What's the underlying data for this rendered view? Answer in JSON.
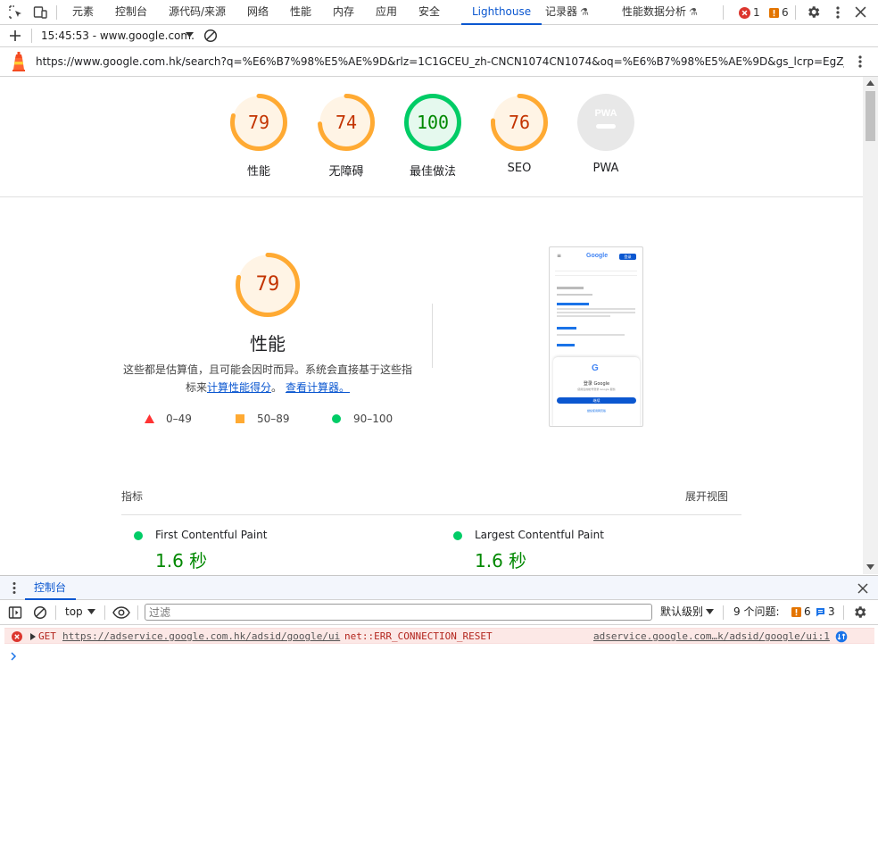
{
  "tabs": [
    {
      "label": "元素"
    },
    {
      "label": "控制台"
    },
    {
      "label": "源代码/来源"
    },
    {
      "label": "网络"
    },
    {
      "label": "性能"
    },
    {
      "label": "内存"
    },
    {
      "label": "应用"
    },
    {
      "label": "安全"
    },
    {
      "label": "Lighthouse"
    },
    {
      "label": "记录器"
    },
    {
      "label": "性能数据分析"
    }
  ],
  "status": {
    "errors": "1",
    "warnings": "6"
  },
  "report_selector": {
    "value": "15:45:53 - www.google.com.hk"
  },
  "url": "https://www.google.com.hk/search?q=%E6%B7%98%E5%AE%9D&rlz=1C1GCEU_zh-CNCN1074CN1074&oq=%E6%B7%98%E5%AE%9D&gs_lcrp=EgZjaHJv...",
  "gauges": [
    {
      "value": "79",
      "label": "性能",
      "score": 0.79
    },
    {
      "value": "74",
      "label": "无障碍",
      "score": 0.74
    },
    {
      "value": "100",
      "label": "最佳做法",
      "score": 1.0
    },
    {
      "value": "76",
      "label": "SEO",
      "score": 0.76
    },
    {
      "value": "PWA",
      "label": "PWA"
    }
  ],
  "perf": {
    "value": "79",
    "score": 0.79,
    "title": "性能",
    "desc_line1": "这些都是估算值，且可能会因时而异。系统会直接基于这些指",
    "desc_line2_prefix": "标来",
    "link1": "计算性能得分",
    "sep": "。",
    "link2": "查看计算器。",
    "legend": [
      {
        "range": "0–49"
      },
      {
        "range": "50–89"
      },
      {
        "range": "90–100"
      }
    ]
  },
  "screenshot": {
    "logo": "Google",
    "login_btn": "登录",
    "sign_in_title": "登录 Google",
    "sign_in_sub": "使用您的帐号登录 Google 服务",
    "continue_btn": "继续",
    "footer_link": "继续使用网页版"
  },
  "metrics": {
    "header": "指标",
    "expand": "展开视图",
    "items": [
      {
        "name": "First Contentful Paint",
        "value": "1.6 秒"
      },
      {
        "name": "Largest Contentful Paint",
        "value": "1.6 秒"
      }
    ]
  },
  "console": {
    "tab": "控制台",
    "context": "top",
    "filter_placeholder": "过滤",
    "level": "默认级别",
    "issues_label": "9 个问题:",
    "issues_warn": "6",
    "issues_info": "3",
    "error": {
      "method": "GET",
      "url": "https://adservice.google.com.hk/adsid/google/ui",
      "msg": "net::ERR_CONNECTION_RESET",
      "source": "adservice.google.com…k/adsid/google/ui:1"
    }
  },
  "colors": {
    "orange": "#fa3",
    "orange_text": "#c33300",
    "green": "#0c6",
    "green_text": "#080",
    "red": "#f33",
    "accent": "#0b57d0"
  }
}
